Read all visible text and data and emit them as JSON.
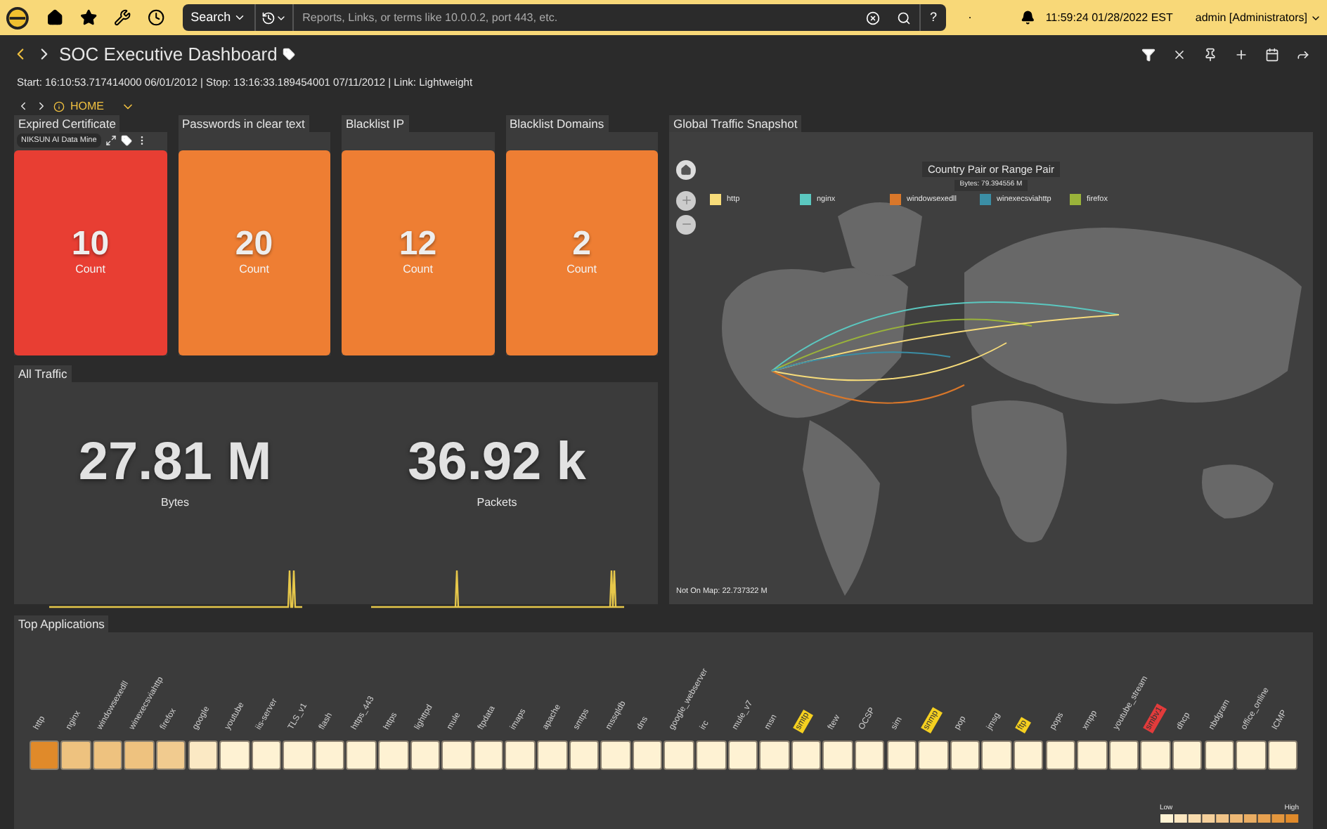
{
  "topbar": {
    "search_button": "Search",
    "search": {
      "placeholder": "Reports, Links, or terms like 10.0.0.2, port 443, etc."
    },
    "help": "?",
    "separator": "·",
    "time": "11:59:24 01/28/2022 EST",
    "user": "admin [Administrators]"
  },
  "header": {
    "title": "SOC Executive Dashboard",
    "range": "Start: 16:10:53.717414000 06/01/2012 | Stop: 13:16:33.189454001 07/11/2012 | Link: Lightweight",
    "breadcrumb": "HOME"
  },
  "cards": [
    {
      "title": "Expired Certificate",
      "value": "10",
      "label": "Count",
      "color": "#e83e33",
      "toolbar": "NIKSUN AI Data Mine"
    },
    {
      "title": "Passwords in clear text",
      "value": "20",
      "label": "Count",
      "color": "#ee7e33"
    },
    {
      "title": "Blacklist IP",
      "value": "12",
      "label": "Count",
      "color": "#ee7e33"
    },
    {
      "title": "Blacklist Domains",
      "value": "2",
      "label": "Count",
      "color": "#ee7e33"
    }
  ],
  "all_traffic": {
    "title": "All Traffic",
    "stats": [
      {
        "value": "27.81 M",
        "label": "Bytes"
      },
      {
        "value": "36.92 k",
        "label": "Packets"
      }
    ]
  },
  "map": {
    "title": "Global Traffic Snapshot",
    "chart_title": "Country Pair or Range Pair",
    "tooltip": "Bytes: 79.394556 M",
    "legend": [
      {
        "label": "http",
        "color": "#f7dc7a"
      },
      {
        "label": "nginx",
        "color": "#5bc8c0"
      },
      {
        "label": "windowsexedll",
        "color": "#d9772a"
      },
      {
        "label": "winexecsviahttp",
        "color": "#3b8ea5"
      },
      {
        "label": "firefox",
        "color": "#9ab33a"
      }
    ],
    "footer": "Not On Map: 22.737322 M"
  },
  "top_apps": {
    "title": "Top Applications",
    "low": "Low",
    "high": "High",
    "apps": [
      {
        "label": "http",
        "color": "#e08a2a"
      },
      {
        "label": "nginx",
        "color": "#eec27f"
      },
      {
        "label": "windowsexedll",
        "color": "#eec27f"
      },
      {
        "label": "winexecsviahttp",
        "color": "#eec27f"
      },
      {
        "label": "firefox",
        "color": "#f1cb8f"
      },
      {
        "label": "google",
        "color": "#fbe9c4"
      },
      {
        "label": "youtube",
        "color": "#fef2d3"
      },
      {
        "label": "iis-server",
        "color": "#fef2d3"
      },
      {
        "label": "TLS_v1",
        "color": "#fef2d3"
      },
      {
        "label": "flash",
        "color": "#fef2d3"
      },
      {
        "label": "https_443",
        "color": "#fef2d3"
      },
      {
        "label": "https",
        "color": "#fef2d3"
      },
      {
        "label": "lighttpd",
        "color": "#fef2d3"
      },
      {
        "label": "mule",
        "color": "#fef2d3"
      },
      {
        "label": "ftpdata",
        "color": "#fef2d3"
      },
      {
        "label": "imaps",
        "color": "#fef2d3"
      },
      {
        "label": "apache",
        "color": "#fef2d3"
      },
      {
        "label": "smtps",
        "color": "#fef2d3"
      },
      {
        "label": "mssqldb",
        "color": "#fef2d3"
      },
      {
        "label": "dns",
        "color": "#fef2d3"
      },
      {
        "label": "google_webserver",
        "color": "#fef2d3"
      },
      {
        "label": "irc",
        "color": "#fef2d3"
      },
      {
        "label": "mule_v7",
        "color": "#fef2d3"
      },
      {
        "label": "msn",
        "color": "#fef2d3"
      },
      {
        "label": "smtp",
        "color": "#fef2d3",
        "kind": "warning"
      },
      {
        "label": "ftew",
        "color": "#fef2d3"
      },
      {
        "label": "OCSP",
        "color": "#fef2d3"
      },
      {
        "label": "sim",
        "color": "#fef2d3"
      },
      {
        "label": "snmp",
        "color": "#fef2d3",
        "kind": "warning"
      },
      {
        "label": "pop",
        "color": "#fef2d3"
      },
      {
        "label": "jmsg",
        "color": "#fef2d3"
      },
      {
        "label": "ftp",
        "color": "#fef2d3",
        "kind": "warning"
      },
      {
        "label": "pops",
        "color": "#fef2d3"
      },
      {
        "label": "xmpp",
        "color": "#fef2d3"
      },
      {
        "label": "youtube_stream",
        "color": "#fef2d3"
      },
      {
        "label": "smbv1",
        "color": "#fef2d3",
        "kind": "alert"
      },
      {
        "label": "dhcp",
        "color": "#fef2d3"
      },
      {
        "label": "nbdgram",
        "color": "#fef2d3"
      },
      {
        "label": "office_online",
        "color": "#fef2d3"
      },
      {
        "label": "ICMP",
        "color": "#fef2d3"
      }
    ]
  }
}
